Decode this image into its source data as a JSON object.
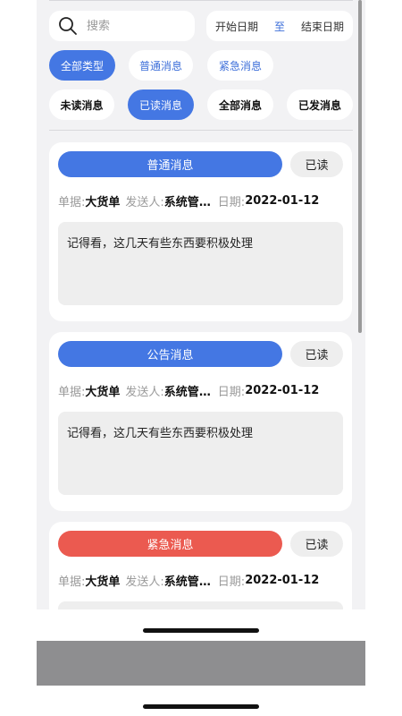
{
  "search": {
    "placeholder": "搜索",
    "date_start": "开始日期",
    "date_sep": "至",
    "date_end": "结束日期"
  },
  "type_filters": [
    "全部类型",
    "普通消息",
    "紧急消息"
  ],
  "type_filters_active": "全部类型",
  "status_filters": [
    "未读消息",
    "已读消息",
    "全部消息",
    "已发消息"
  ],
  "status_filters_active": "已读消息",
  "labels": {
    "doc": "单据:",
    "sender": "发送人:",
    "date": "日期:"
  },
  "colors": {
    "accent": "#4477e3",
    "urgent": "#eb5a50"
  },
  "messages": [
    {
      "type": "普通消息",
      "status": "已读",
      "doc": "大货单",
      "sender": "系统管理员",
      "date": "2022-01-12",
      "content": "记得看，这几天有些东西要积极处理",
      "color": "#4477e3"
    },
    {
      "type": "公告消息",
      "status": "已读",
      "doc": "大货单",
      "sender": "系统管理员",
      "date": "2022-01-12",
      "content": "记得看，这几天有些东西要积极处理",
      "color": "#4477e3"
    },
    {
      "type": "紧急消息",
      "status": "已读",
      "doc": "大货单",
      "sender": "系统管理员",
      "date": "2022-01-12",
      "content": "",
      "color": "#eb5a50"
    }
  ]
}
